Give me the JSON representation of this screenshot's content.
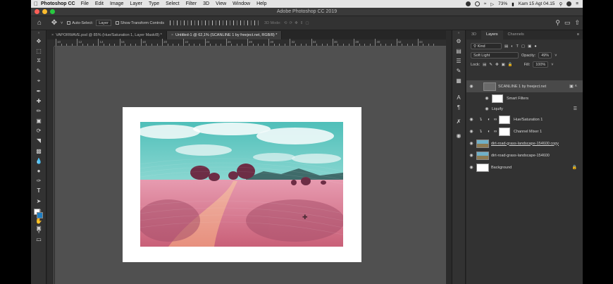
{
  "menubar": {
    "app_name": "Photoshop CC",
    "items": [
      "File",
      "Edit",
      "Image",
      "Layer",
      "Type",
      "Select",
      "Filter",
      "3D",
      "View",
      "Window",
      "Help"
    ],
    "battery": "73%",
    "clock": "Kam 15 Agt  04.15"
  },
  "window": {
    "title": "Adobe Photoshop CC 2019"
  },
  "options": {
    "auto_select_label": "Auto-Select:",
    "auto_select_value": "Layer",
    "transform_label": "Show Transform Controls",
    "mode_3d": "3D Mode:"
  },
  "tabs": [
    {
      "label": "VAPORWAVE.psd @ 85% (Hue/Saturation 1, Layer Mask/8) *"
    },
    {
      "label": "Untitled-1 @ 62,1% (SCANLINE 1 by freeject.net, RGB/8) *"
    }
  ],
  "ruler": {
    "ticks": [
      "10",
      "12",
      "14",
      "16",
      "18",
      "20",
      "22",
      "24",
      "26",
      "28",
      "30",
      "32",
      "34",
      "36",
      "38",
      "40",
      "42",
      "44"
    ]
  },
  "panel": {
    "tabs": [
      "3D",
      "Layers",
      "Channels"
    ],
    "filter_kind": "Kind",
    "blend_mode": "Soft Light",
    "opacity_label": "Opacity:",
    "opacity_value": "49%",
    "lock_label": "Lock:",
    "fill_label": "Fill:",
    "fill_value": "100%"
  },
  "layers": [
    {
      "name": "SCANLINE 1 by freeject.net",
      "selected": true
    },
    {
      "name": "Smart Filters"
    },
    {
      "name": "Liquify"
    },
    {
      "name": "Hue/Saturation 1"
    },
    {
      "name": "Channel Mixer 1"
    },
    {
      "name": "dirt-road-grass-landscape-154600 copy"
    },
    {
      "name": "dirt-road-grass-landscape-154600"
    },
    {
      "name": "Background"
    }
  ],
  "colors": {
    "foreground": "#ffffff",
    "background": "#1f7fc4",
    "accent_sky": "#5fc8c4",
    "accent_field": "#e0809a"
  }
}
